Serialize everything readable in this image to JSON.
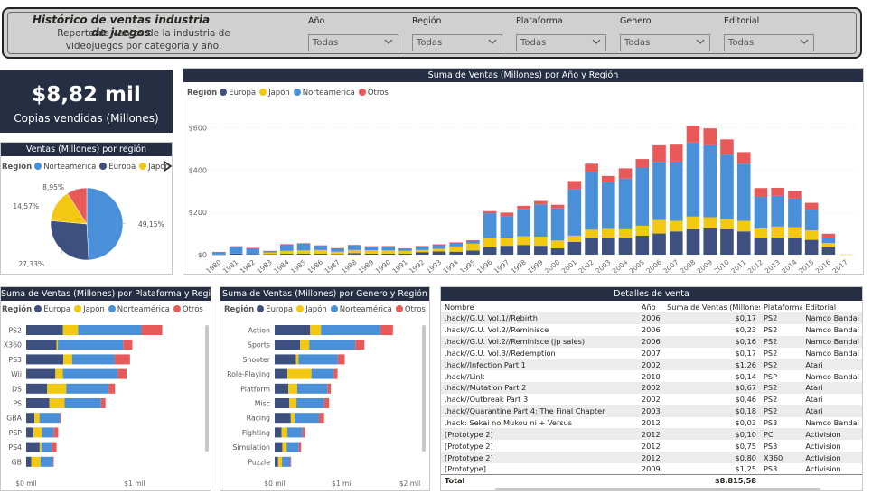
{
  "header": {
    "title": "Histórico de ventas industria de juegos",
    "subtitle": "Reporte de ventas de la industria de videojuegos por categoría y año.",
    "filters": [
      {
        "label": "Año",
        "value": "Todas"
      },
      {
        "label": "Región",
        "value": "Todas"
      },
      {
        "label": "Plataforma",
        "value": "Todas"
      },
      {
        "label": "Genero",
        "value": "Todas"
      },
      {
        "label": "Editorial",
        "value": "Todas"
      }
    ]
  },
  "kpi": {
    "value": "$8,82 mil",
    "label": "Copias vendidas (Millones)"
  },
  "colors": {
    "Europa": "#3d5080",
    "Japón": "#f2c811",
    "Norteamérica": "#4a90d9",
    "Otros": "#e85a5a"
  },
  "legend_title": "Región",
  "year_chart": {
    "title": "Suma de Ventas (Millones) por Año y Región",
    "legend": [
      "Europa",
      "Japón",
      "Norteamérica",
      "Otros"
    ],
    "y_ticks": [
      "$0",
      "$200",
      "$400",
      "$600"
    ],
    "ylim": [
      0,
      700
    ],
    "chart_data": {
      "type": "bar",
      "stacked": true,
      "categories": [
        "1980",
        "1981",
        "1982",
        "1983",
        "1984",
        "1985",
        "1986",
        "1987",
        "1988",
        "1989",
        "1990",
        "1991",
        "1992",
        "1993",
        "1994",
        "1995",
        "1996",
        "1997",
        "1998",
        "1999",
        "2000",
        "2001",
        "2002",
        "2003",
        "2004",
        "2005",
        "2006",
        "2007",
        "2008",
        "2009",
        "2010",
        "2011",
        "2012",
        "2013",
        "2014",
        "2015",
        "2016",
        "2017"
      ],
      "series": [
        {
          "name": "Europa",
          "values": [
            1,
            5,
            3,
            2,
            4,
            5,
            4,
            2,
            7,
            5,
            5,
            5,
            12,
            15,
            14,
            20,
            35,
            42,
            46,
            42,
            30,
            60,
            80,
            80,
            80,
            90,
            100,
            110,
            120,
            125,
            120,
            110,
            78,
            81,
            80,
            70,
            35,
            0
          ]
        },
        {
          "name": "Japón",
          "values": [
            0,
            0,
            0,
            8,
            14,
            15,
            18,
            12,
            15,
            16,
            15,
            13,
            10,
            13,
            25,
            32,
            43,
            38,
            41,
            43,
            37,
            30,
            38,
            42,
            40,
            47,
            64,
            50,
            60,
            52,
            48,
            50,
            45,
            52,
            50,
            45,
            20,
            1
          ]
        },
        {
          "name": "Norteamérica",
          "values": [
            11,
            33,
            28,
            7,
            30,
            33,
            21,
            16,
            23,
            18,
            20,
            11,
            18,
            20,
            18,
            15,
            118,
            103,
            128,
            153,
            152,
            220,
            274,
            220,
            240,
            275,
            275,
            280,
            350,
            340,
            305,
            270,
            150,
            145,
            135,
            98,
            22,
            0
          ]
        },
        {
          "name": "Otros",
          "values": [
            1,
            2,
            1,
            1,
            2,
            1,
            1,
            1,
            1,
            1,
            1,
            1,
            1,
            1,
            1,
            1,
            10,
            16,
            16,
            16,
            17,
            38,
            38,
            30,
            48,
            40,
            78,
            80,
            80,
            80,
            72,
            55,
            42,
            38,
            35,
            32,
            22,
            0
          ]
        }
      ],
      "xlabel": "",
      "ylabel": ""
    }
  },
  "pie_chart": {
    "title": "Ventas (Millones) por región",
    "legend": [
      "Norteamérica",
      "Europa",
      "Japón"
    ],
    "chart_data": {
      "type": "pie",
      "labels": [
        "Norteamérica",
        "Europa",
        "Japón",
        "Otros"
      ],
      "values": [
        49.15,
        27.33,
        14.57,
        8.95
      ],
      "data_labels": [
        "49,15%",
        "27,33%",
        "14,57%",
        "8,95%"
      ]
    }
  },
  "platform_chart": {
    "title": "Suma de Ventas (Millones) por Plataforma y Región",
    "legend": [
      "Europa",
      "Japón",
      "Norteamérica",
      "Otros"
    ],
    "x_ticks": [
      "$0 mil",
      "$1 mil"
    ],
    "chart_data": {
      "type": "bar",
      "orientation": "horizontal",
      "stacked": true,
      "categories": [
        "PS2",
        "X360",
        "PS3",
        "Wii",
        "DS",
        "PS",
        "GBA",
        "PSP",
        "PS4",
        "GB"
      ],
      "series": [
        {
          "name": "Europa",
          "values": [
            339,
            280,
            343,
            269,
            194,
            213,
            75,
            68,
            124,
            47
          ]
        },
        {
          "name": "Japón",
          "values": [
            139,
            12,
            80,
            69,
            175,
            140,
            47,
            76,
            16,
            85
          ]
        },
        {
          "name": "Norteamérica",
          "values": [
            584,
            602,
            393,
            507,
            390,
            337,
            187,
            108,
            96,
            114
          ]
        },
        {
          "name": "Otros",
          "values": [
            193,
            85,
            141,
            81,
            60,
            41,
            8,
            43,
            44,
            8
          ]
        }
      ],
      "xlim": [
        0,
        1300
      ]
    }
  },
  "genre_chart": {
    "title": "Suma de Ventas (Millones) por Genero y Región",
    "legend": [
      "Europa",
      "Japón",
      "Norteamérica",
      "Otros"
    ],
    "x_ticks": [
      "$0 mil",
      "$1 mil",
      "$2 mil"
    ],
    "chart_data": {
      "type": "bar",
      "orientation": "horizontal",
      "stacked": true,
      "categories": [
        "Action",
        "Sports",
        "Shooter",
        "Role-Playing",
        "Platform",
        "Misc",
        "Racing",
        "Fighting",
        "Simulation",
        "Puzzle"
      ],
      "series": [
        {
          "name": "Europa",
          "values": [
            525,
            376,
            314,
            188,
            202,
            215,
            238,
            101,
            113,
            51
          ]
        },
        {
          "name": "Japón",
          "values": [
            160,
            135,
            38,
            356,
            131,
            107,
            57,
            87,
            63,
            57
          ]
        },
        {
          "name": "Norteamérica",
          "values": [
            878,
            683,
            582,
            327,
            447,
            410,
            360,
            223,
            183,
            123
          ]
        },
        {
          "name": "Otros",
          "values": [
            187,
            134,
            103,
            60,
            51,
            74,
            77,
            37,
            32,
            13
          ]
        }
      ],
      "xlim": [
        0,
        2100
      ]
    }
  },
  "details": {
    "title": "Detalles de venta",
    "columns": [
      "Nombre",
      "Año",
      "Suma de Ventas (Millones)",
      "Plataforma",
      "Editorial"
    ],
    "rows": [
      [
        ".hack//G.U. Vol.1//Rebirth",
        "2006",
        "$0,17",
        "PS2",
        "Namco Bandai G"
      ],
      [
        ".hack//G.U. Vol.2//Reminisce",
        "2006",
        "$0,23",
        "PS2",
        "Namco Bandai G"
      ],
      [
        ".hack//G.U. Vol.2//Reminisce (jp sales)",
        "2006",
        "$0,16",
        "PS2",
        "Namco Bandai G"
      ],
      [
        ".hack//G.U. Vol.3//Redemption",
        "2007",
        "$0,17",
        "PS2",
        "Namco Bandai G"
      ],
      [
        ".hack//Infection Part 1",
        "2002",
        "$1,26",
        "PS2",
        "Atari"
      ],
      [
        ".hack//Link",
        "2010",
        "$0,14",
        "PSP",
        "Namco Bandai G"
      ],
      [
        ".hack//Mutation Part 2",
        "2002",
        "$0,67",
        "PS2",
        "Atari"
      ],
      [
        ".hack//Outbreak Part 3",
        "2002",
        "$0,46",
        "PS2",
        "Atari"
      ],
      [
        ".hack//Quarantine Part 4: The Final Chapter",
        "2003",
        "$0,18",
        "PS2",
        "Atari"
      ],
      [
        ".hack: Sekai no Mukou ni + Versus",
        "2012",
        "$0,03",
        "PS3",
        "Namco Bandai G"
      ],
      [
        "[Prototype 2]",
        "2012",
        "$0,10",
        "PC",
        "Activision"
      ],
      [
        "[Prototype 2]",
        "2012",
        "$0,75",
        "PS3",
        "Activision"
      ],
      [
        "[Prototype 2]",
        "2012",
        "$0,80",
        "X360",
        "Activision"
      ],
      [
        "[Prototype]",
        "2009",
        "$1,25",
        "PS3",
        "Activision"
      ]
    ],
    "total_label": "Total",
    "total_value": "$8.815,58"
  }
}
